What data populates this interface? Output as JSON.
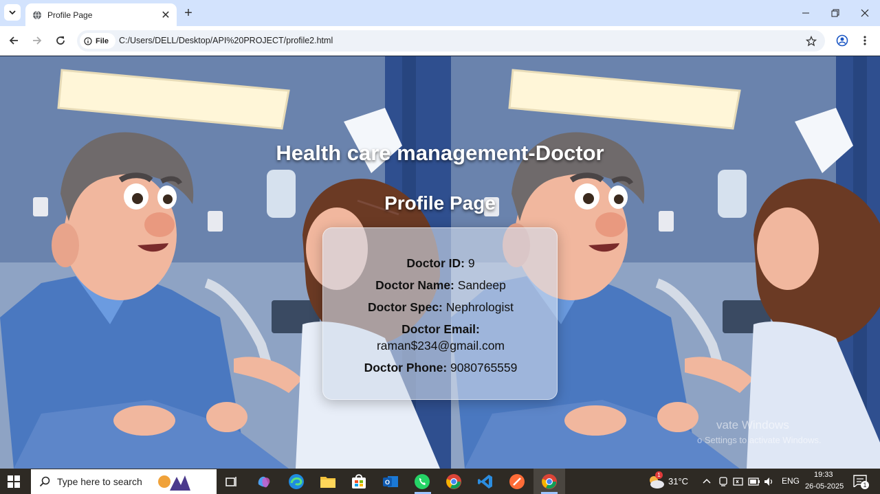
{
  "browser": {
    "tab_title": "Profile Page",
    "url_chip": "File",
    "url": "C:/Users/DELL/Desktop/API%20PROJECT/profile2.html"
  },
  "page": {
    "heading": "Health care management-Doctor",
    "subheading": "Profile Page",
    "profile": {
      "id_label": "Doctor ID:",
      "id_value": "9",
      "name_label": "Doctor Name:",
      "name_value": "Sandeep",
      "spec_label": "Doctor Spec:",
      "spec_value": "Nephrologist",
      "email_label": "Doctor Email:",
      "email_value": "raman$234@gmail.com",
      "phone_label": "Doctor Phone:",
      "phone_value": "9080765559"
    },
    "watermark_line1": "vate Windows",
    "watermark_line2": "o Settings to activate Windows."
  },
  "taskbar": {
    "search_placeholder": "Type here to search",
    "weather": "31°C",
    "language": "ENG",
    "time": "19:33",
    "date": "26-05-2025",
    "notification_count": "1",
    "weather_badge": "1"
  }
}
